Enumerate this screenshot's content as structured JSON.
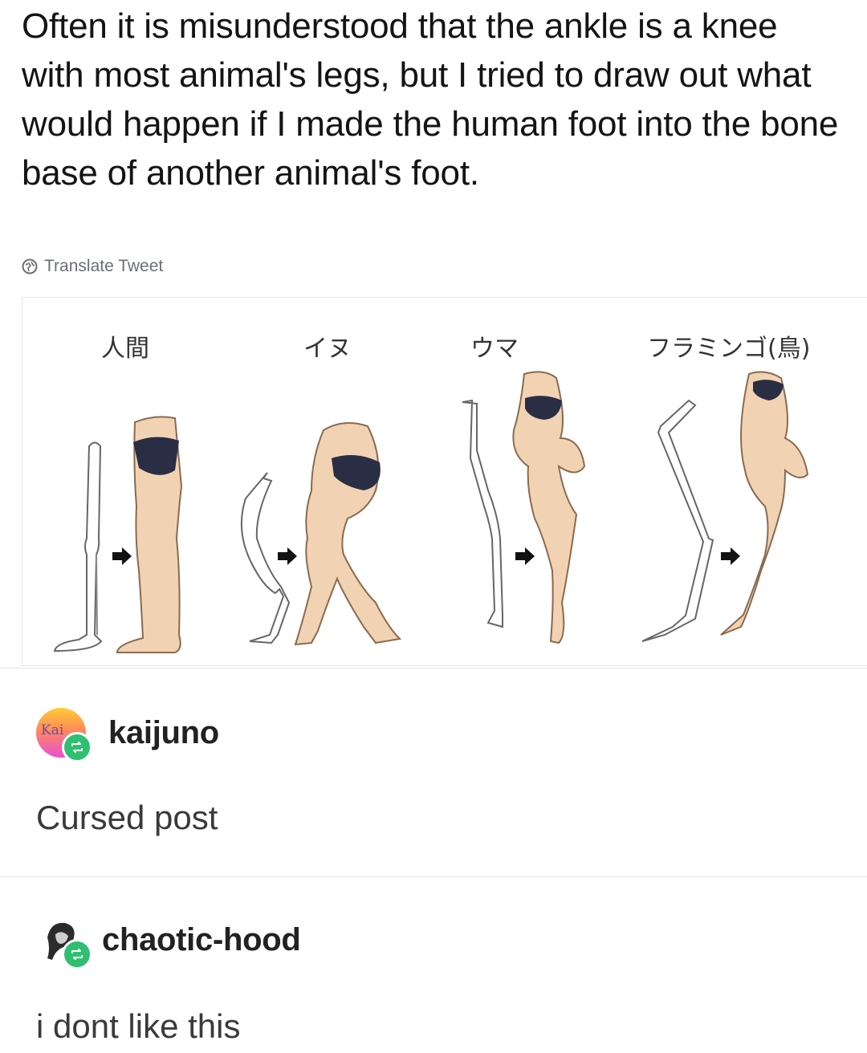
{
  "tweet": {
    "text": "Often it is misunderstood that the ankle is a knee with most animal's legs, but I tried to draw out what would happen if I made the human foot into the bone base of another animal's foot.",
    "translate_label": "Translate Tweet"
  },
  "figure": {
    "labels": [
      "人間",
      "イヌ",
      "ウマ",
      "フラミンゴ(鳥)"
    ]
  },
  "posts": [
    {
      "username": "kaijuno",
      "avatar_text": "Kai",
      "text": "Cursed post"
    },
    {
      "username": "chaotic-hood",
      "text": "i dont like this"
    }
  ],
  "colors": {
    "skin": "#f1d3b3",
    "underwear": "#2a2e45",
    "reblog": "#2fbf71"
  }
}
